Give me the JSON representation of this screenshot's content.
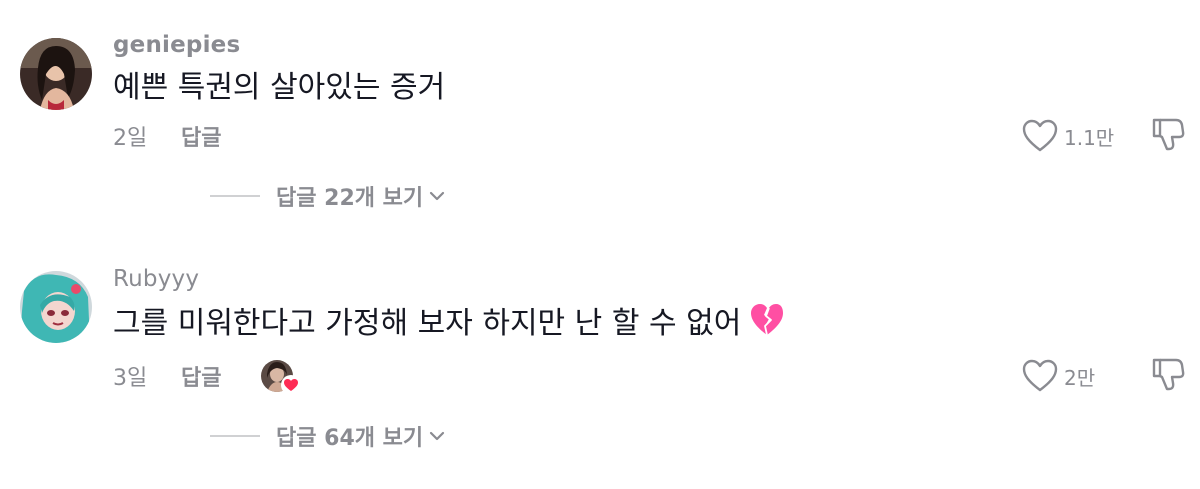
{
  "comments": [
    {
      "username": "geniepies",
      "text": "예쁜 특권의 살아있는 증거",
      "time": "2일",
      "reply_label": "답글",
      "like_count": "1.1만",
      "view_replies": "답글 22개 보기",
      "avatar_icon": "user-avatar-photo"
    },
    {
      "username": "Rubyyy",
      "text": "그를 미워한다고 가정해 보자 하지만 난 할 수 없어",
      "emoji": "broken-heart-icon",
      "time": "3일",
      "reply_label": "답글",
      "like_count": "2만",
      "view_replies": "답글 64개 보기",
      "avatar_icon": "anime-avatar",
      "liked_by_creator": true
    }
  ],
  "icons": {
    "like": "heart-outline-icon",
    "dislike": "thumbs-down-icon",
    "expand": "chevron-down-icon"
  },
  "colors": {
    "text_primary": "#161823",
    "text_secondary": "#8a8b91",
    "divider": "#d0d1d3",
    "broken_heart": "#ff4fa3",
    "creator_heart": "#fe2c55"
  }
}
